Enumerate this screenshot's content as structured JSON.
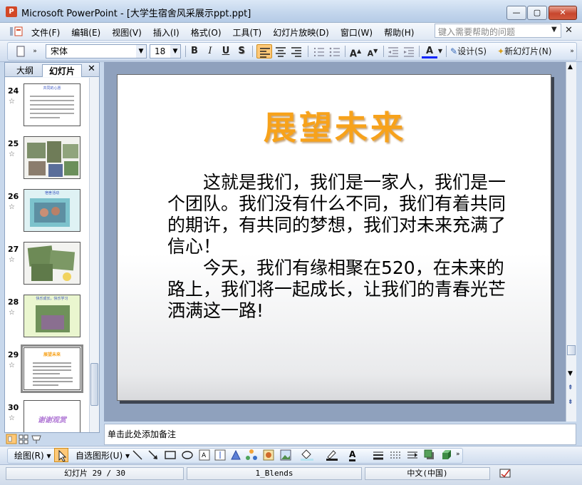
{
  "window": {
    "title": "Microsoft PowerPoint - [大学生宿舍风采展示ppt.ppt]",
    "app_icon": "P",
    "controls": {
      "minimize": "—",
      "maximize": "▢",
      "close": "✕"
    }
  },
  "menu": {
    "items": [
      "文件(F)",
      "编辑(E)",
      "视图(V)",
      "插入(I)",
      "格式(O)",
      "工具(T)",
      "幻灯片放映(D)",
      "窗口(W)",
      "帮助(H)"
    ],
    "help_placeholder": "键入需要帮助的问题",
    "close_doc": "✕"
  },
  "format_toolbar": {
    "font_name": "宋体",
    "font_size": "18",
    "bold": "B",
    "italic": "I",
    "underline": "U",
    "shadow": "S",
    "design_label": "设计(S)",
    "new_slide_label": "新幻灯片(N)"
  },
  "left_pane": {
    "tab_outline": "大纲",
    "tab_slides": "幻灯片",
    "close": "✕",
    "thumbnails": [
      {
        "num": "24",
        "title": "共同的心愿"
      },
      {
        "num": "25",
        "title": ""
      },
      {
        "num": "26",
        "title": "宿舍活动"
      },
      {
        "num": "27",
        "title": ""
      },
      {
        "num": "28",
        "title": "快乐成长，快乐学习"
      },
      {
        "num": "29",
        "title": "展望未来",
        "selected": true
      },
      {
        "num": "30",
        "title": "谢谢观赏"
      }
    ]
  },
  "slide": {
    "title": "展望未来",
    "paragraph1": "这就是我们，我们是一家人，我们是一个团队。我们没有什么不同，我们有着共同的期许，有共同的梦想，我们对未来充满了信心！",
    "paragraph2": "今天，我们有缘相聚在520，在未来的路上，我们将一起成长，让我们的青春光芒洒满这一路!"
  },
  "notes": {
    "placeholder": "单击此处添加备注"
  },
  "draw_toolbar": {
    "draw_label": "绘图(R)",
    "autoshape_label": "自选图形(U)"
  },
  "status": {
    "slide_info": "幻灯片 29 / 30",
    "design": "1_Blends",
    "language": "中文(中国)"
  },
  "colors": {
    "title_orange": "#f7a21b",
    "selection_highlight": "#ffc978",
    "workspace": "#8fa1bd"
  }
}
